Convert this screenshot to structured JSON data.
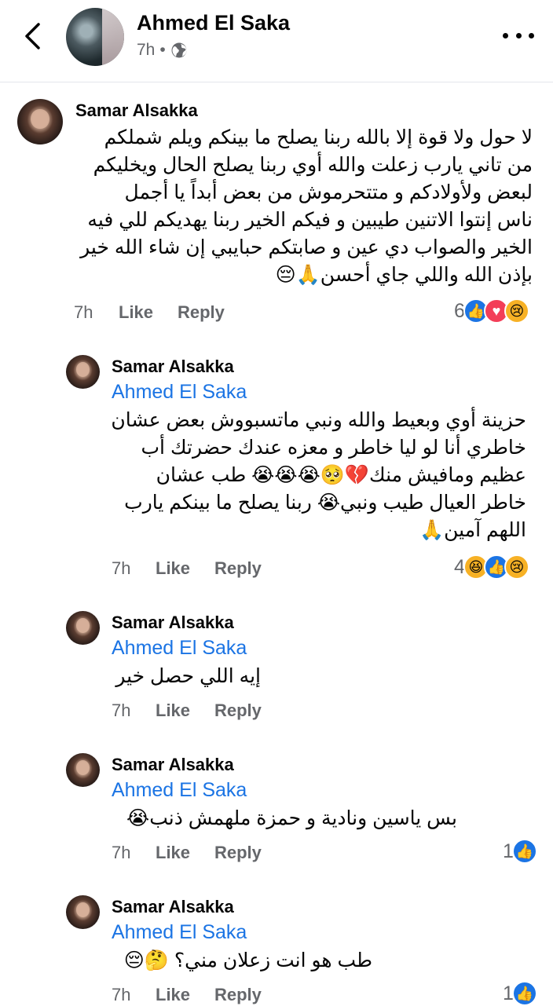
{
  "header": {
    "name": "Ahmed El Saka",
    "time": "7h",
    "separator": "•"
  },
  "comments": [
    {
      "author": "Samar Alsakka",
      "text": "لا حول ولا قوة إلا بالله ربنا يصلح ما بينكم ويلم شملكم\nمن تاني يارب زعلت والله أوي ربنا يصلح الحال ويخليكم\nلبعض ولأولادكم و متتحرموش من بعض أبداً يا أجمل\nناس إنتوا الاتنين طيبين و فيكم الخير ربنا يهديكم للي فيه\nالخير والصواب دي عين و صابتكم حبايبي إن شاء الله خير\nبإذن الله واللي جاي أحسن🙏😔",
      "time": "7h",
      "like": "Like",
      "reply": "Reply",
      "reaction_count": "6"
    },
    {
      "author": "Samar Alsakka",
      "mention": "Ahmed El Saka",
      "text": "حزينة أوي وبعيط والله ونبي ماتسبووش بعض عشان\nخاطري أنا لو ليا خاطر و معزه عندك حضرتك أب\nعظيم ومافيش منك💔🥺😭😭😭 طب عشان\nخاطر العيال طيب ونبي😭 ربنا يصلح ما بينكم يارب\nاللهم آمين🙏",
      "time": "7h",
      "like": "Like",
      "reply": "Reply",
      "reaction_count": "4"
    },
    {
      "author": "Samar Alsakka",
      "mention": "Ahmed El Saka",
      "text": "إيه اللي حصل خير",
      "time": "7h",
      "like": "Like",
      "reply": "Reply"
    },
    {
      "author": "Samar Alsakka",
      "mention": "Ahmed El Saka",
      "text": "بس ياسين ونادية و حمزة ملهمش ذنب😭",
      "time": "7h",
      "like": "Like",
      "reply": "Reply",
      "reaction_count": "1"
    },
    {
      "author": "Samar Alsakka",
      "mention": "Ahmed El Saka",
      "text": "طب هو انت زعلان مني؟ 🤔😔",
      "time": "7h",
      "like": "Like",
      "reply": "Reply",
      "reaction_count": "1"
    }
  ]
}
